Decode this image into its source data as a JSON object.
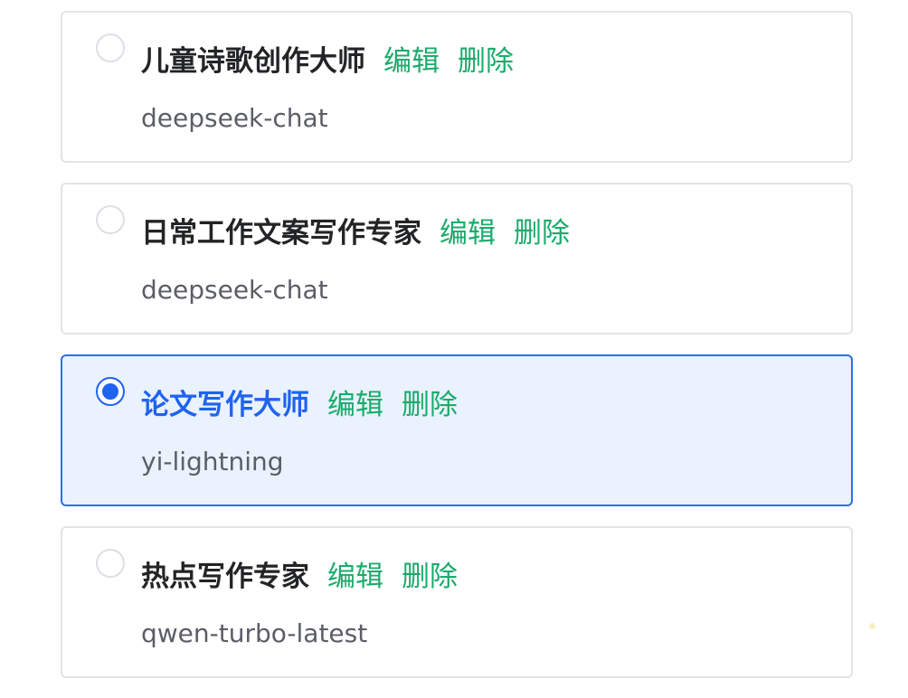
{
  "assistants": [
    {
      "name": "儿童诗歌创作大师",
      "edit_label": "编辑",
      "delete_label": "删除",
      "model": "deepseek-chat",
      "selected": false
    },
    {
      "name": "日常工作文案写作专家",
      "edit_label": "编辑",
      "delete_label": "删除",
      "model": "deepseek-chat",
      "selected": false
    },
    {
      "name": "论文写作大师",
      "edit_label": "编辑",
      "delete_label": "删除",
      "model": "yi-lightning",
      "selected": true
    },
    {
      "name": "热点写作专家",
      "edit_label": "编辑",
      "delete_label": "删除",
      "model": "qwen-turbo-latest",
      "selected": false
    }
  ],
  "colors": {
    "action": "#1aab6b",
    "selected_accent": "#1f63f0",
    "selected_background": "#e9f2fd",
    "border": "#e2e4e8"
  }
}
